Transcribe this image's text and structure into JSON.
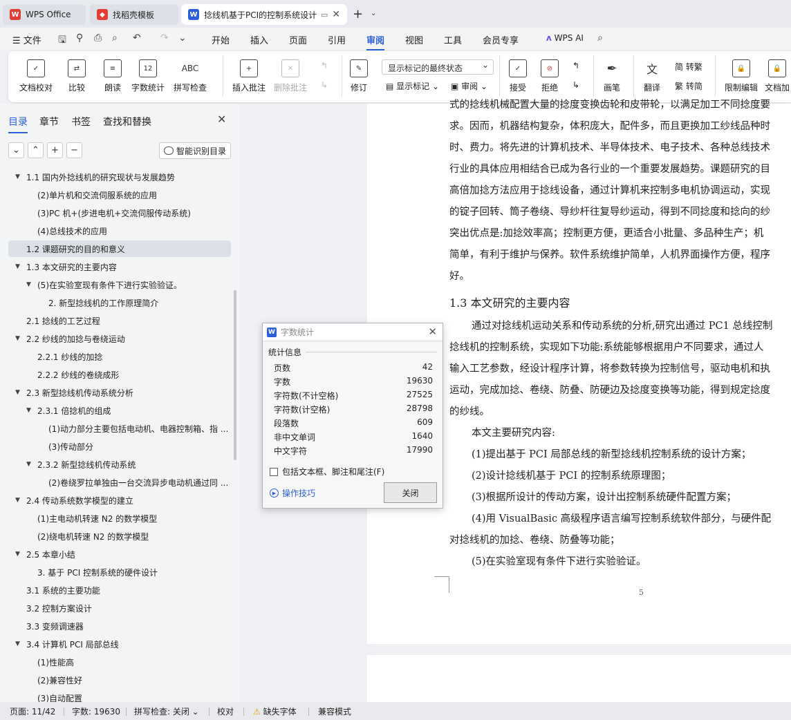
{
  "tabs": [
    {
      "label": "WPS Office",
      "color": "#e33e33"
    },
    {
      "label": "找稻壳模板",
      "color": "#e33e33"
    },
    {
      "label": "捻线机基于PCI的控制系统设计",
      "color": "#2b5fd9"
    }
  ],
  "menu": {
    "file": "文件",
    "items": [
      "开始",
      "插入",
      "页面",
      "引用",
      "审阅",
      "视图",
      "工具",
      "会员专享"
    ],
    "active": "审阅",
    "ai": "WPS AI"
  },
  "ribbon": {
    "doc_proof": "文档校对",
    "compare": "比较",
    "read": "朗读",
    "word_count": "字数统计",
    "word_count_icon": "12",
    "spell_check": "拼写检查",
    "spell_icon": "ABC",
    "insert_comment": "插入批注",
    "delete_comment": "删除批注",
    "revise": "修订",
    "markup_select": "显示标记的最终状态",
    "show_markup": "显示标记",
    "review": "审阅",
    "accept": "接受",
    "reject": "拒绝",
    "pen": "画笔",
    "translate": "翻译",
    "trad": "简 转繁",
    "simp": "繁 转简",
    "restrict": "限制编辑",
    "doc_add": "文档加"
  },
  "panel": {
    "tabs": [
      "目录",
      "章节",
      "书签",
      "查找和替换"
    ],
    "smart_toc": "智能识别目录",
    "toc": [
      {
        "text": "1.1  国内外捻线机的研究现状与发展趋势",
        "level": 1,
        "arrow": true
      },
      {
        "text": "(2)单片机和交流伺服系统的应用",
        "level": 2,
        "arrow": false
      },
      {
        "text": "(3)PC 机+(步进电机+交流伺服传动系统)",
        "level": 2,
        "arrow": false
      },
      {
        "text": "(4)总线技术的应用",
        "level": 2,
        "arrow": false
      },
      {
        "text": "1.2  课题研究的目的和意义",
        "level": 1,
        "arrow": false,
        "selected": true
      },
      {
        "text": "1.3  本文研究的主要内容",
        "level": 1,
        "arrow": true
      },
      {
        "text": "(5)在实验室现有条件下进行实验验证。",
        "level": 2,
        "arrow": true
      },
      {
        "text": "2.  新型捻线机的工作原理简介",
        "level": 3,
        "arrow": false
      },
      {
        "text": "2.1  捻线的工艺过程",
        "level": 1,
        "arrow": false
      },
      {
        "text": "2.2  纱线的加捻与卷绕运动",
        "level": 1,
        "arrow": true
      },
      {
        "text": "2.2.1  纱线的加捻",
        "level": 2,
        "arrow": false
      },
      {
        "text": "2.2.2  纱线的卷绕成形",
        "level": 2,
        "arrow": false
      },
      {
        "text": "2.3  新型捻线机传动系统分析",
        "level": 1,
        "arrow": true
      },
      {
        "text": "2.3.1  倍捻机的组成",
        "level": 2,
        "arrow": true
      },
      {
        "text": "(1)动力部分主要包括电动机、电器控制箱、指 ...",
        "level": 3,
        "arrow": false
      },
      {
        "text": "(3)传动部分",
        "level": 3,
        "arrow": false
      },
      {
        "text": "2.3.2  新型捻线机传动系统",
        "level": 2,
        "arrow": true
      },
      {
        "text": "(2)卷绕罗拉单独由一台交流异步电动机通过同 ...",
        "level": 3,
        "arrow": false
      },
      {
        "text": "2.4  传动系统数学模型的建立",
        "level": 1,
        "arrow": true
      },
      {
        "text": "(1)主电动机转速 N2 的数学模型",
        "level": 2,
        "arrow": false
      },
      {
        "text": "(2)绕电机转速 N2 的数学模型",
        "level": 2,
        "arrow": false
      },
      {
        "text": "2.5  本章小结",
        "level": 1,
        "arrow": true
      },
      {
        "text": "3.  基于 PCI 控制系统的硬件设计",
        "level": 2,
        "arrow": false
      },
      {
        "text": "3.1  系统的主要功能",
        "level": 1,
        "arrow": false
      },
      {
        "text": "3.2 控制方案设计",
        "level": 1,
        "arrow": false
      },
      {
        "text": "3.3  变频调速器",
        "level": 1,
        "arrow": false
      },
      {
        "text": "3.4  计算机 PCI 局部总线",
        "level": 1,
        "arrow": true
      },
      {
        "text": "(1)性能高",
        "level": 2,
        "arrow": false
      },
      {
        "text": "(2)兼容性好",
        "level": 2,
        "arrow": false
      },
      {
        "text": "(3)自动配置",
        "level": 2,
        "arrow": false
      }
    ]
  },
  "document": {
    "lines": [
      "式的捻线机械配置大量的捻度变换齿轮和皮带轮，以满足加工不同捻度要",
      "求。因而，机器结构复杂，体积庞大，配件多，而且更换加工纱线品种时",
      "时、费力。将先进的计算机技术、半导体技术、电子技术、各种总线技术",
      "行业的具体应用相结合已成为各行业的一个重要发展趋势。课题研究的目",
      "高倍加捻方法应用于捻线设备，通过计算机来控制多电机协调运动，实现",
      "的锭子回转、筒子卷绕、导纱杆往复导纱运动，得到不同捻度和捻向的纱",
      "突出优点是:加捻效率高；控制更方便，更适合小批量、多品种生产；机",
      "简单，有利于维护与保养。软件系统维护简单，人机界面操作方便，程序",
      "好。"
    ],
    "heading": "1.3  本文研究的主要内容",
    "lines2": [
      "通过对捻线机运动关系和传动系统的分析,研究出通过 PC1 总线控制",
      "捻线机的控制系统，实现如下功能:系统能够根据用户不同要求，通过人",
      "输入工艺参数，经设计程序计算，将参数转换为控制信号，驱动电机和执",
      "运动，完成加捻、卷绕、防叠、防硬边及捻度变换等功能，得到规定捻度",
      "的纱线。",
      "本文主要研究内容:",
      "(1)提出基于 PCI 局部总线的新型捻线机控制系统的设计方案；",
      "(2)设计捻线机基于 PCI 的控制系统原理图；",
      "(3)根据所设计的传动方案，设计出控制系统硬件配置方案；",
      "(4)用 VisualBasic 高级程序语言编写控制系统软件部分，与硬件配",
      "对捻线机的加捻、卷绕、防叠等功能；",
      "(5)在实验室现有条件下进行实验验证。"
    ],
    "page_number": "5"
  },
  "dialog": {
    "title": "字数统计",
    "section": "统计信息",
    "rows": [
      {
        "label": "页数",
        "value": "42"
      },
      {
        "label": "字数",
        "value": "19630"
      },
      {
        "label": "字符数(不计空格)",
        "value": "27525"
      },
      {
        "label": "字符数(计空格)",
        "value": "28798"
      },
      {
        "label": "段落数",
        "value": "609"
      },
      {
        "label": "非中文单词",
        "value": "1640"
      },
      {
        "label": "中文字符",
        "value": "17990"
      }
    ],
    "checkbox": "包括文本框、脚注和尾注(F)",
    "tips": "操作技巧",
    "close": "关闭"
  },
  "status": {
    "page": "页面: 11/42",
    "words": "字数: 19630",
    "spell": "拼写检查: 关闭",
    "proof": "校对",
    "missing_font": "缺失字体",
    "compat": "兼容模式"
  }
}
